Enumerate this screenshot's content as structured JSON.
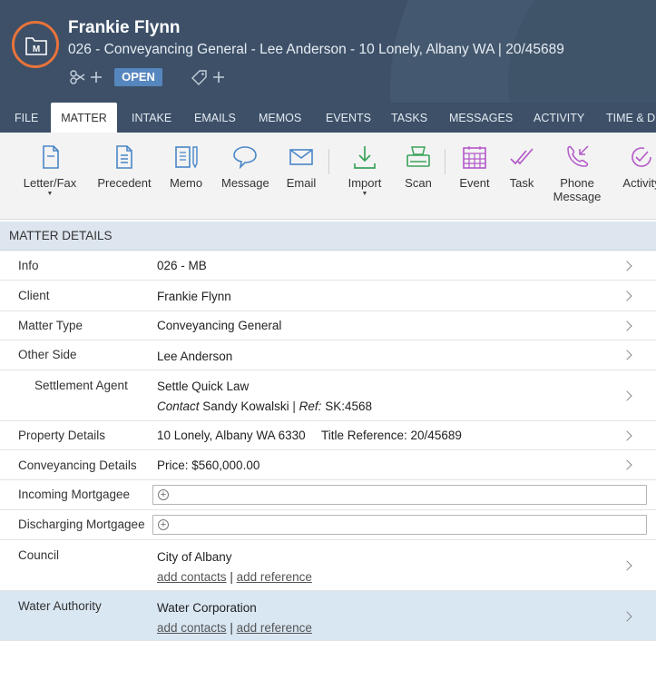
{
  "header": {
    "client_name": "Frankie Flynn",
    "matter_description": "026 - Conveyancing General - Lee Anderson - 10 Lonely, Albany WA | 20/45689",
    "status_badge": "OPEN",
    "colors": {
      "header_bg": "#3d5068",
      "logo_ring": "#e8733a",
      "badge_bg": "#5686be"
    }
  },
  "tabs": [
    {
      "label": "FILE"
    },
    {
      "label": "MATTER",
      "active": true
    },
    {
      "label": "INTAKE"
    },
    {
      "label": "EMAILS"
    },
    {
      "label": "MEMOS"
    },
    {
      "label": "EVENTS"
    },
    {
      "label": "TASKS"
    },
    {
      "label": "MESSAGES"
    },
    {
      "label": "ACTIVITY"
    },
    {
      "label": "TIME & DI"
    }
  ],
  "toolbar": {
    "letter_fax": "Letter/Fax",
    "precedent": "Precedent",
    "memo": "Memo",
    "message": "Message",
    "email": "Email",
    "import": "Import",
    "scan": "Scan",
    "event": "Event",
    "task": "Task",
    "phone_message_1": "Phone",
    "phone_message_2": "Message",
    "activity": "Activity"
  },
  "section": {
    "title": "MATTER DETAILS"
  },
  "details": {
    "info": {
      "label": "Info",
      "value": "026 - MB"
    },
    "client": {
      "label": "Client",
      "value": "Frankie Flynn"
    },
    "matter_type": {
      "label": "Matter Type",
      "value": "Conveyancing General"
    },
    "other_side": {
      "label": "Other Side",
      "value": "Lee Anderson"
    },
    "settlement_agent": {
      "label": "Settlement Agent",
      "value": "Settle Quick Law",
      "contact_label": "Contact",
      "contact_value": "Sandy Kowalski",
      "ref_label": "Ref:",
      "ref_value": "SK:4568"
    },
    "property_details": {
      "label": "Property Details",
      "value": "10 Lonely, Albany WA 6330",
      "title_ref": "Title Reference: 20/45689"
    },
    "conveyancing_details": {
      "label": "Conveyancing Details",
      "value": "Price: $560,000.00"
    },
    "incoming_mortgagee": {
      "label": "Incoming Mortgagee"
    },
    "discharging_mortgagee": {
      "label": "Discharging Mortgagee"
    },
    "council": {
      "label": "Council",
      "value": "City of Albany",
      "add_contacts": "add contacts",
      "add_reference": "add reference"
    },
    "water_authority": {
      "label": "Water Authority",
      "value": "Water Corporation",
      "add_contacts": "add contacts",
      "add_reference": "add reference"
    }
  },
  "icons": {
    "tool_color_blue": "#4a86c8",
    "tool_color_green": "#3aa35b",
    "tool_color_purple": "#b357c9"
  }
}
